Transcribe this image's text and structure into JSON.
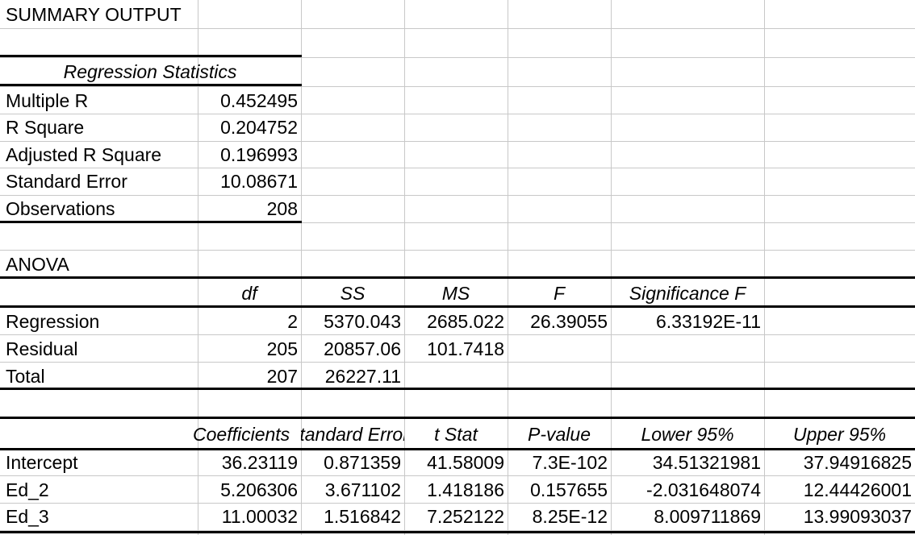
{
  "title": "SUMMARY OUTPUT",
  "regression_statistics": {
    "header": "Regression Statistics",
    "rows": [
      {
        "label": "Multiple R",
        "value": "0.452495"
      },
      {
        "label": "R Square",
        "value": "0.204752"
      },
      {
        "label": "Adjusted R Square",
        "value": "0.196993"
      },
      {
        "label": "Standard Error",
        "value": "10.08671"
      },
      {
        "label": "Observations",
        "value": "208"
      }
    ]
  },
  "anova": {
    "label": "ANOVA",
    "columns": [
      "",
      "df",
      "SS",
      "MS",
      "F",
      "Significance F",
      ""
    ],
    "rows": [
      [
        "Regression",
        "2",
        "5370.043",
        "2685.022",
        "26.39055",
        "6.33192E-11",
        ""
      ],
      [
        "Residual",
        "205",
        "20857.06",
        "101.7418",
        "",
        "",
        ""
      ],
      [
        "Total",
        "207",
        "26227.11",
        "",
        "",
        "",
        ""
      ]
    ]
  },
  "coefficients": {
    "columns": [
      "",
      "Coefficients",
      "Standard Error",
      "t Stat",
      "P-value",
      "Lower 95%",
      "Upper 95%"
    ],
    "rows": [
      [
        "Intercept",
        "36.23119",
        "0.871359",
        "41.58009",
        "7.3E-102",
        "34.51321981",
        "37.94916825"
      ],
      [
        "Ed_2",
        "5.206306",
        "3.671102",
        "1.418186",
        "0.157655",
        "-2.031648074",
        "12.44426001"
      ],
      [
        "Ed_3",
        "11.00032",
        "1.516842",
        "7.252122",
        "8.25E-12",
        "8.009711869",
        "13.99093037"
      ]
    ]
  }
}
